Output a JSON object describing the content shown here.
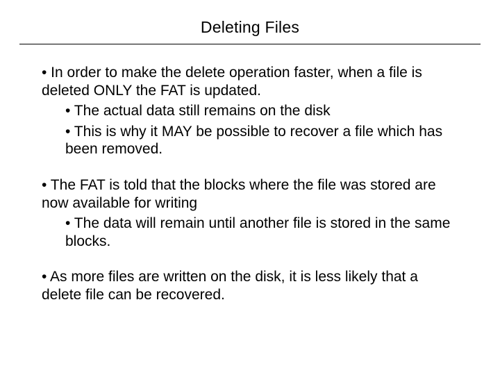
{
  "slide": {
    "title": "Deleting Files",
    "p1": "• In order to make the delete operation faster, when a file is deleted ONLY the FAT is updated.",
    "p1a": "• The actual data still remains on the disk",
    "p1b": "• This is why it MAY be possible to recover a file which has been removed.",
    "p2": "• The FAT is told that the blocks where the file was stored are now available for writing",
    "p2a": "• The data will remain until another file is stored in the same blocks.",
    "p3": "• As more files are written on the disk, it is less likely that a delete file can be recovered."
  }
}
